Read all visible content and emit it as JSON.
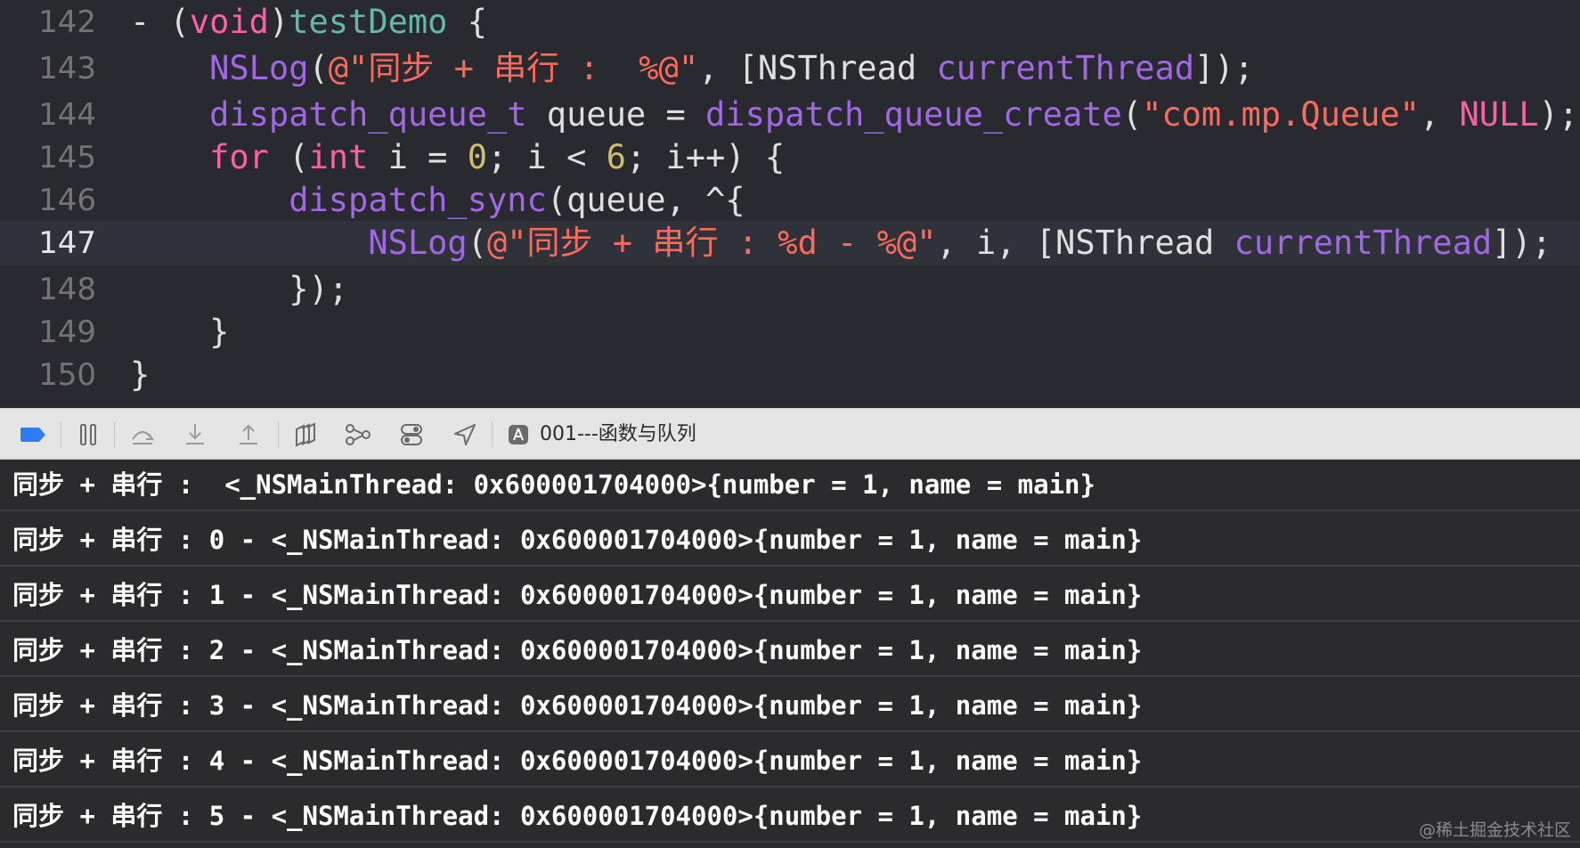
{
  "colors": {
    "editor_bg": "#292a30",
    "keyword": "#fc5fa3",
    "string": "#fc6a5d",
    "number": "#d0bf69",
    "function": "#a167e6",
    "method_name": "#67b7a4",
    "plain": "#dfdfe0",
    "console_bg": "#2b2b2d",
    "toolbar_bg": "#e5e5e5",
    "breakpoint_blue": "#2f7bf5"
  },
  "editor": {
    "current_line": "147",
    "lines": [
      {
        "number": "142",
        "tokens": [
          {
            "t": "- (",
            "c": "plain"
          },
          {
            "t": "void",
            "c": "kw"
          },
          {
            "t": ")",
            "c": "plain"
          },
          {
            "t": "testDemo",
            "c": "fnname"
          },
          {
            "t": " {",
            "c": "plain"
          }
        ]
      },
      {
        "number": "143",
        "tokens": [
          {
            "t": "    ",
            "c": "plain"
          },
          {
            "t": "NSLog",
            "c": "func"
          },
          {
            "t": "(",
            "c": "plain"
          },
          {
            "t": "@\"同步 + 串行 :  %@\"",
            "c": "str"
          },
          {
            "t": ", [NSThread ",
            "c": "plain"
          },
          {
            "t": "currentThread",
            "c": "func"
          },
          {
            "t": "]);",
            "c": "plain"
          }
        ]
      },
      {
        "number": "144",
        "tokens": [
          {
            "t": "    ",
            "c": "plain"
          },
          {
            "t": "dispatch_queue_t",
            "c": "type"
          },
          {
            "t": " queue = ",
            "c": "plain"
          },
          {
            "t": "dispatch_queue_create",
            "c": "func"
          },
          {
            "t": "(",
            "c": "plain"
          },
          {
            "t": "\"com.mp.Queue\"",
            "c": "str"
          },
          {
            "t": ", ",
            "c": "plain"
          },
          {
            "t": "NULL",
            "c": "const"
          },
          {
            "t": ");",
            "c": "plain"
          }
        ]
      },
      {
        "number": "145",
        "tokens": [
          {
            "t": "    ",
            "c": "plain"
          },
          {
            "t": "for",
            "c": "kw"
          },
          {
            "t": " (",
            "c": "plain"
          },
          {
            "t": "int",
            "c": "kw"
          },
          {
            "t": " i = ",
            "c": "plain"
          },
          {
            "t": "0",
            "c": "num"
          },
          {
            "t": "; i < ",
            "c": "plain"
          },
          {
            "t": "6",
            "c": "num"
          },
          {
            "t": "; i++) {",
            "c": "plain"
          }
        ]
      },
      {
        "number": "146",
        "tokens": [
          {
            "t": "        ",
            "c": "plain"
          },
          {
            "t": "dispatch_sync",
            "c": "func"
          },
          {
            "t": "(queue, ^{",
            "c": "plain"
          }
        ]
      },
      {
        "number": "147",
        "tokens": [
          {
            "t": "            ",
            "c": "plain"
          },
          {
            "t": "NSLog",
            "c": "func"
          },
          {
            "t": "(",
            "c": "plain"
          },
          {
            "t": "@\"同步 + 串行 : %d - %@\"",
            "c": "str"
          },
          {
            "t": ", i, [NSThread ",
            "c": "plain"
          },
          {
            "t": "currentThread",
            "c": "func"
          },
          {
            "t": "]);",
            "c": "plain"
          }
        ]
      },
      {
        "number": "148",
        "tokens": [
          {
            "t": "        });",
            "c": "plain"
          }
        ]
      },
      {
        "number": "149",
        "tokens": [
          {
            "t": "    }",
            "c": "plain"
          }
        ]
      },
      {
        "number": "150",
        "tokens": [
          {
            "t": "}",
            "c": "plain"
          }
        ]
      }
    ]
  },
  "toolbar": {
    "scheme_label": "001---函数与队列",
    "icons": [
      {
        "name": "breakpoints-toggle-icon",
        "glyph": ""
      },
      {
        "name": "pause-icon",
        "glyph": "❚❚"
      },
      {
        "name": "step-over-icon",
        "glyph": "⏏"
      },
      {
        "name": "step-into-icon",
        "glyph": "⤓"
      },
      {
        "name": "step-out-icon",
        "glyph": "⤒"
      },
      {
        "name": "view-hierarchy-icon",
        "glyph": "◫"
      },
      {
        "name": "memory-graph-icon",
        "glyph": "⚯"
      },
      {
        "name": "environment-overrides-icon",
        "glyph": "⧉"
      },
      {
        "name": "simulate-location-icon",
        "glyph": "➤"
      }
    ]
  },
  "console": {
    "lines": [
      "同步 + 串行 :  <_NSMainThread: 0x600001704000>{number = 1, name = main}",
      "同步 + 串行 : 0 - <_NSMainThread: 0x600001704000>{number = 1, name = main}",
      "同步 + 串行 : 1 - <_NSMainThread: 0x600001704000>{number = 1, name = main}",
      "同步 + 串行 : 2 - <_NSMainThread: 0x600001704000>{number = 1, name = main}",
      "同步 + 串行 : 3 - <_NSMainThread: 0x600001704000>{number = 1, name = main}",
      "同步 + 串行 : 4 - <_NSMainThread: 0x600001704000>{number = 1, name = main}",
      "同步 + 串行 : 5 - <_NSMainThread: 0x600001704000>{number = 1, name = main}"
    ]
  },
  "watermark": "@稀土掘金技术社区"
}
